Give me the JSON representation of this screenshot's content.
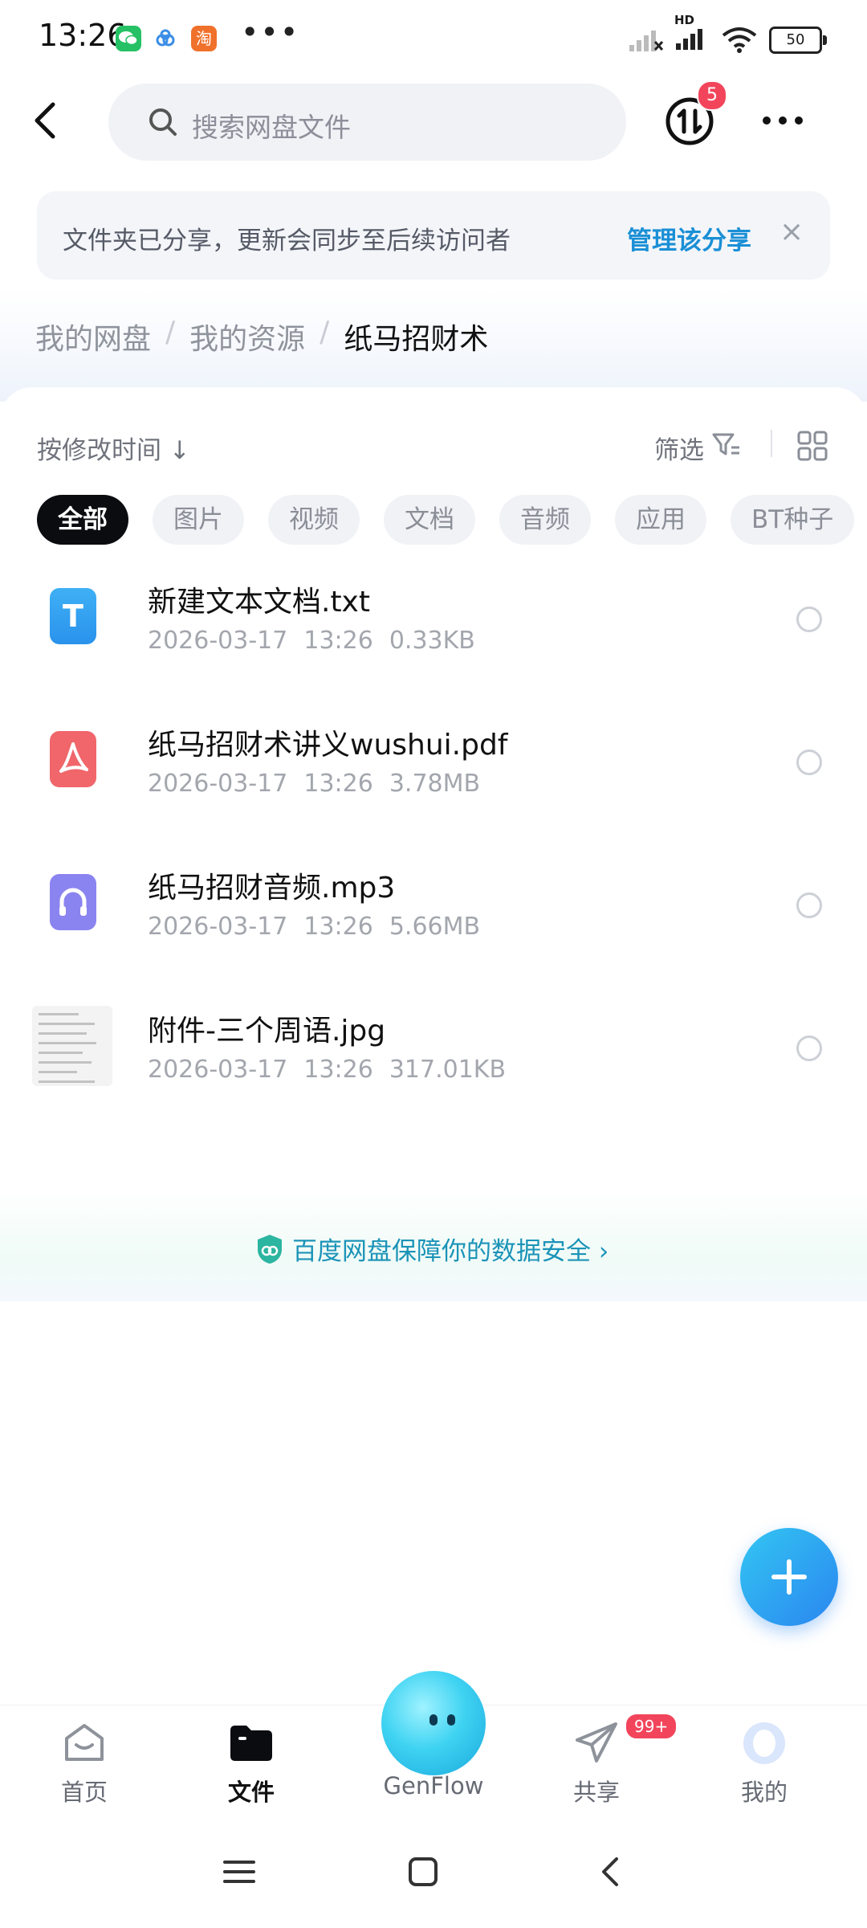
{
  "status_bar": {
    "time": "13:26",
    "app_icons": [
      "wechat-icon",
      "baidu-netdisk-icon",
      "taobao-icon"
    ],
    "taobao_glyph": "淘",
    "overflow": "•••",
    "hd_label": "HD",
    "battery": "50"
  },
  "search": {
    "placeholder": "搜索网盘文件"
  },
  "transfer": {
    "badge": "5"
  },
  "banner": {
    "text": "文件夹已分享，更新会同步至后续访问者",
    "link": "管理该分享",
    "close": "×"
  },
  "breadcrumb": {
    "items": [
      "我的网盘",
      "我的资源",
      "纸马招财术"
    ],
    "separator": "/"
  },
  "toolbar": {
    "sort_label": "按修改时间 ↓",
    "filter_label": "筛选"
  },
  "chips": [
    "全部",
    "图片",
    "视频",
    "文档",
    "音频",
    "应用",
    "BT种子"
  ],
  "files": [
    {
      "name": "新建文本文档.txt",
      "date": "2026-03-17",
      "time": "13:26",
      "size": "0.33KB",
      "icon": "txt-file-icon",
      "glyph": "T"
    },
    {
      "name": "纸马招财术讲义wushui.pdf",
      "date": "2026-03-17",
      "time": "13:26",
      "size": "3.78MB",
      "icon": "pdf-file-icon"
    },
    {
      "name": "纸马招财音频.mp3",
      "date": "2026-03-17",
      "time": "13:26",
      "size": "5.66MB",
      "icon": "audio-file-icon"
    },
    {
      "name": "附件-三个周语.jpg",
      "date": "2026-03-17",
      "time": "13:26",
      "size": "317.01KB",
      "icon": "image-thumbnail"
    }
  ],
  "safety": {
    "text": "百度网盘保障你的数据安全 ›"
  },
  "nav": {
    "home": "首页",
    "files": "文件",
    "genflow": "GenFlow",
    "share": "共享",
    "share_badge": "99+",
    "me": "我的"
  },
  "colors": {
    "accent": "#1a8fd6",
    "badge": "#f2455b",
    "txt_icon": "#2fa2f0",
    "pdf_icon": "#f0666b",
    "audio_icon": "#8a84f0",
    "fab": "#2a86f0"
  }
}
